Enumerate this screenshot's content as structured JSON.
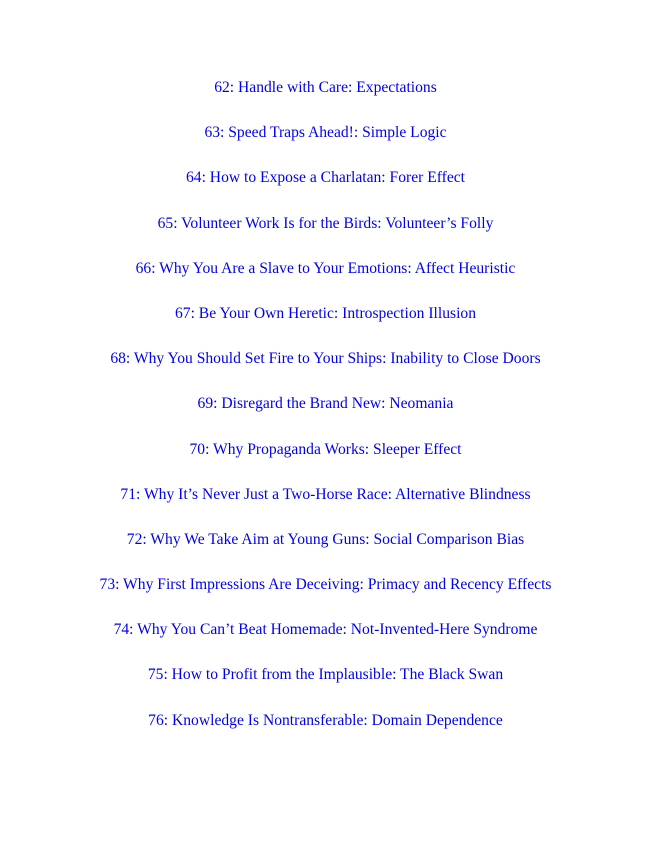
{
  "colors": {
    "link": "#0000ee",
    "background": "#ffffff"
  },
  "toc": {
    "items": [
      {
        "label": "62: Handle with Care: Expectations"
      },
      {
        "label": "63: Speed Traps Ahead!: Simple Logic"
      },
      {
        "label": "64: How to Expose a Charlatan: Forer Effect"
      },
      {
        "label": "65: Volunteer Work Is for the Birds: Volunteer’s Folly"
      },
      {
        "label": "66: Why You Are a Slave to Your Emotions: Affect Heuristic"
      },
      {
        "label": "67: Be Your Own Heretic: Introspection Illusion"
      },
      {
        "label": "68: Why You Should Set Fire to Your Ships: Inability to Close Doors"
      },
      {
        "label": "69: Disregard the Brand New: Neomania"
      },
      {
        "label": "70: Why Propaganda Works: Sleeper Effect"
      },
      {
        "label": "71: Why It’s Never Just a Two-Horse Race: Alternative Blindness"
      },
      {
        "label": "72: Why We Take Aim at Young Guns: Social Comparison Bias"
      },
      {
        "label": "73: Why First Impressions Are Deceiving: Primacy and Recency Effects"
      },
      {
        "label": "74: Why You Can’t Beat Homemade: Not-Invented-Here Syndrome"
      },
      {
        "label": "75: How to Profit from the Implausible: The Black Swan"
      },
      {
        "label": "76: Knowledge Is Nontransferable: Domain Dependence"
      }
    ]
  }
}
